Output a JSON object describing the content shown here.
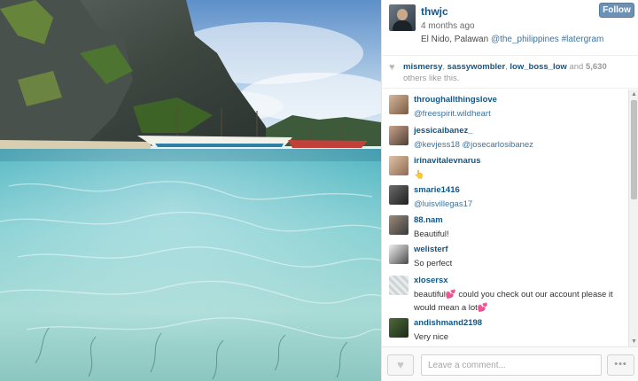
{
  "post": {
    "username": "thwjc",
    "time_ago": "4 months ago",
    "location_text": "El Nido, Palawan ",
    "location_links": "@the_philippines #latergram",
    "follow_label": "Follow"
  },
  "likes": {
    "icon": "heart-icon",
    "user1": "mismersy",
    "user2": "sassywombler",
    "user3": "low_boss_low",
    "and_text": " and ",
    "count": "5,630",
    "suffix": " others like this."
  },
  "comments": [
    {
      "user": "throughallthingslove",
      "text": "@freespirit.wildheart"
    },
    {
      "user": "jessicaibanez_",
      "text": "@kevjess18 @josecarlosibanez"
    },
    {
      "user": "irinavitalevnarus",
      "text": "👆"
    },
    {
      "user": "smarie1416",
      "text": "@luisvillegas17"
    },
    {
      "user": "88.nam",
      "text": "Beautiful!"
    },
    {
      "user": "welisterf",
      "text": "So perfect"
    },
    {
      "user": "xlosersx",
      "text": "beautiful💕 could you check out our account please it would mean a lot💕"
    },
    {
      "user": "andishmand2198",
      "text": "Very nice"
    }
  ],
  "footer": {
    "like_icon": "heart-icon",
    "comment_placeholder": "Leave a comment...",
    "more_icon": "ellipsis-icon",
    "more_label": "•••"
  },
  "colors": {
    "username": "#125688",
    "link": "#3f729b",
    "follow_bg": "#6d90b5"
  }
}
